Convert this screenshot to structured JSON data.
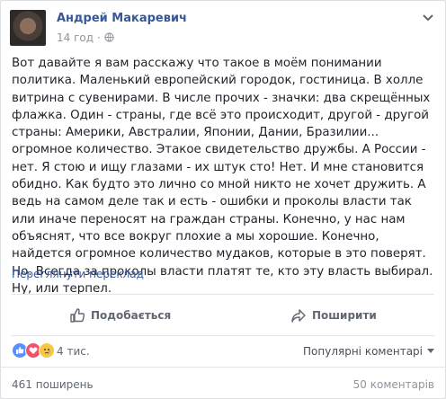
{
  "post": {
    "author": "Андрей Макаревич",
    "time": "14 год",
    "dot": "·",
    "text": "Вот давайте я вам расскажу что такое в моём понимании политика. Маленький европейский городок, гостиница. В холле витрина с сувенирами. В числе прочих - значки: два скрещённых флажка. Один - страны, где всё это происходит, другой - другой страны: Америки, Австралии, Японии, Дании, Бразилии... огромное количество. Этакое свидетельство дружбы. А России - нет. Я стою и ищу глазами - их штук сто! Нет. И мне становится обидно. Как будто это лично со мной никто не хочет дружить. А ведь на самом деле так и есть - ошибки и проколы власти так или иначе переносят на граждан страны. Конечно, у нас нам объяснят, что все вокруг плохие а мы хорошие. Конечно, найдется огромное количество мудаков, которые в это поверят. Но. Всегда за проколы власти платят те, кто эту власть выбирал. Ну, или терпел.",
    "translate_link": "Переглянути переклад"
  },
  "actions": {
    "like_label": "Подобається",
    "share_label": "Поширити"
  },
  "stats": {
    "reactions_count": "4 тис.",
    "sort_label": "Популярні коментарі",
    "shares": "461 поширень",
    "comments": "50 коментарів"
  },
  "icons": {
    "privacy": "globe-icon",
    "menu": "chevron-down-icon",
    "like": "thumbs-up-icon",
    "share": "share-arrow-icon",
    "reactions": [
      "like-reaction-icon",
      "love-reaction-icon",
      "sad-reaction-icon"
    ]
  },
  "colors": {
    "link": "#365899",
    "text": "#1d2129",
    "muted": "#90949c",
    "like_blue": "#5890ff",
    "love_red": "#f25268",
    "sad_yellow": "#f7c742"
  }
}
